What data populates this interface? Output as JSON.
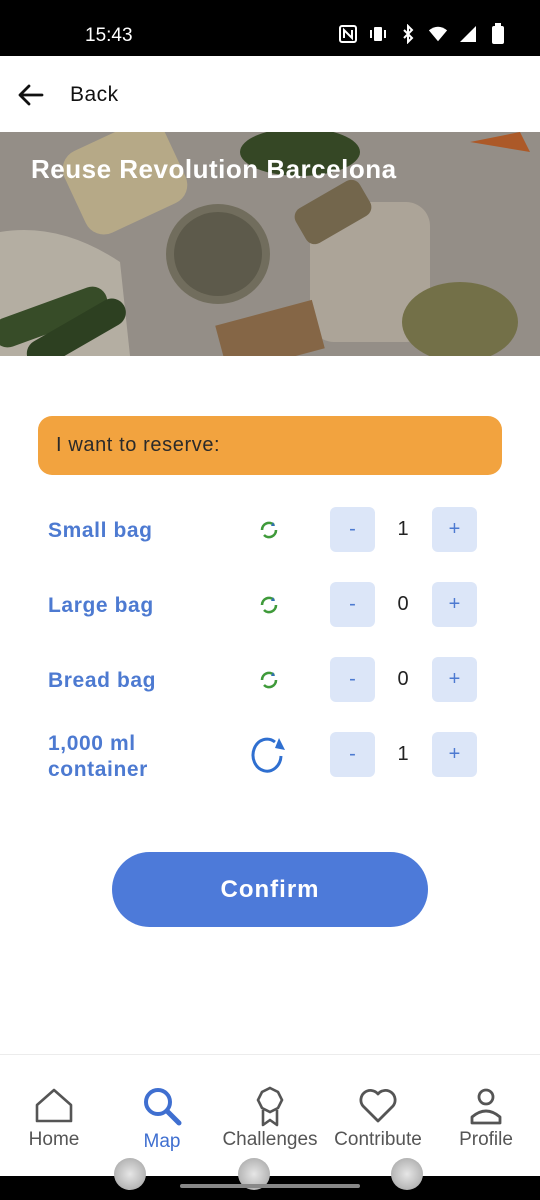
{
  "status_bar": {
    "time": "15:43",
    "icons": [
      "nfc-icon",
      "vibrate-icon",
      "bluetooth-icon",
      "wifi-icon",
      "signal-icon",
      "battery-icon"
    ]
  },
  "app_bar": {
    "back_label": "Back"
  },
  "hero": {
    "title": "Reuse Revolution Barcelona"
  },
  "reserve": {
    "header": "I want to reserve:",
    "items": [
      {
        "label": "Small bag",
        "icon": "green-cycle-icon",
        "minus": "-",
        "plus": "+",
        "quantity": "1"
      },
      {
        "label": "Large bag",
        "icon": "green-cycle-icon",
        "minus": "-",
        "plus": "+",
        "quantity": "0"
      },
      {
        "label": "Bread bag",
        "icon": "green-cycle-icon",
        "minus": "-",
        "plus": "+",
        "quantity": "0"
      },
      {
        "label": "1,000 ml container",
        "icon": "blue-refresh-arrow-icon",
        "minus": "-",
        "plus": "+",
        "quantity": "1"
      }
    ]
  },
  "confirm_label": "Confirm",
  "bottom_nav": {
    "items": [
      {
        "label": "Home",
        "icon": "home-icon",
        "active": false
      },
      {
        "label": "Map",
        "icon": "search-icon",
        "active": true
      },
      {
        "label": "Challenges",
        "icon": "badge-icon",
        "active": false
      },
      {
        "label": "Contribute",
        "icon": "heart-icon",
        "active": false
      },
      {
        "label": "Profile",
        "icon": "person-icon",
        "active": false
      }
    ]
  },
  "colors": {
    "accent": "#4d7ad9",
    "reserve_header": "#f2a33f",
    "stepper_bg": "#dce6f8",
    "eco_green": "#3f9a3a"
  }
}
